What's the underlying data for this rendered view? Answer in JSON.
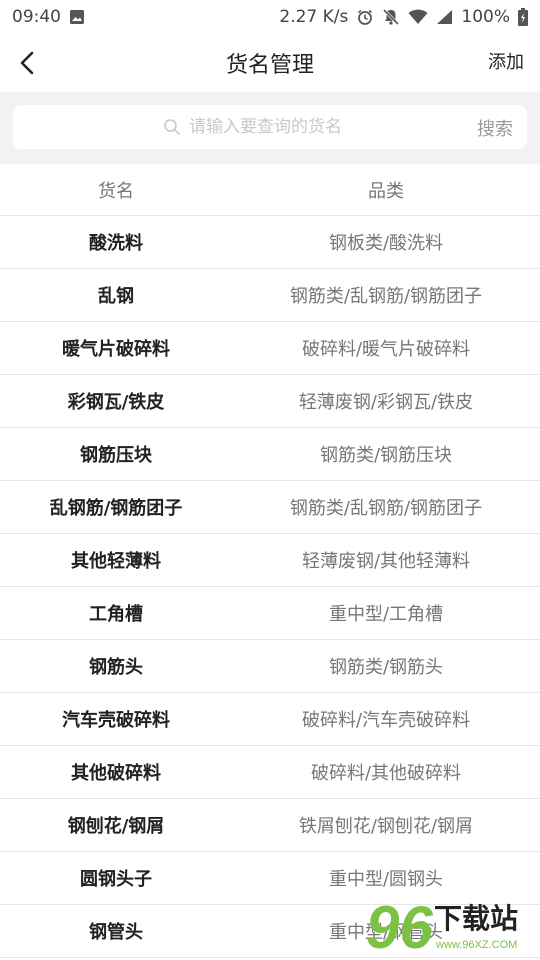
{
  "status_bar": {
    "time": "09:40",
    "net_speed": "2.27 K/s",
    "battery": "100%"
  },
  "header": {
    "title": "货名管理",
    "add_label": "添加"
  },
  "search": {
    "placeholder": "请输入要查询的货名",
    "button_label": "搜索"
  },
  "table": {
    "columns": [
      "货名",
      "品类"
    ],
    "rows": [
      {
        "name": "酸洗料",
        "category": "钢板类/酸洗料"
      },
      {
        "name": "乱钢",
        "category": "钢筋类/乱钢筋/钢筋团子"
      },
      {
        "name": "暖气片破碎料",
        "category": "破碎料/暖气片破碎料"
      },
      {
        "name": "彩钢瓦/铁皮",
        "category": "轻薄废钢/彩钢瓦/铁皮"
      },
      {
        "name": "钢筋压块",
        "category": "钢筋类/钢筋压块"
      },
      {
        "name": "乱钢筋/钢筋团子",
        "category": "钢筋类/乱钢筋/钢筋团子"
      },
      {
        "name": "其他轻薄料",
        "category": "轻薄废钢/其他轻薄料"
      },
      {
        "name": "工角槽",
        "category": "重中型/工角槽"
      },
      {
        "name": "钢筋头",
        "category": "钢筋类/钢筋头"
      },
      {
        "name": "汽车壳破碎料",
        "category": "破碎料/汽车壳破碎料"
      },
      {
        "name": "其他破碎料",
        "category": "破碎料/其他破碎料"
      },
      {
        "name": "钢刨花/钢屑",
        "category": "铁屑刨花/钢刨花/钢屑"
      },
      {
        "name": "圆钢头子",
        "category": "重中型/圆钢头"
      },
      {
        "name": "钢管头",
        "category": "重中型/钢管头"
      }
    ]
  },
  "watermark": {
    "logo_text": "96",
    "brand_text": "下载站",
    "url_text": "www.96XZ.COM"
  },
  "colors": {
    "search_bg": "#f2f2f2",
    "divider": "#e6e6e6",
    "watermark_green": "#7cc242"
  }
}
